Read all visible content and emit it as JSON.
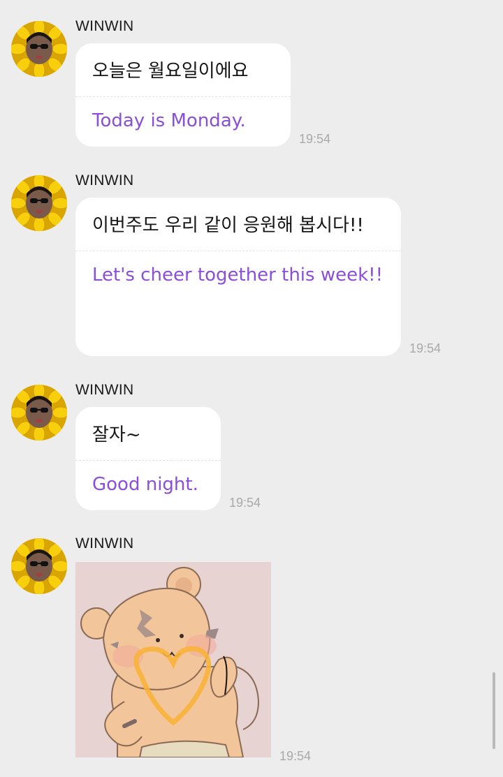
{
  "messages": [
    {
      "sender": "WINWIN",
      "korean": "오늘은 월요일이에요",
      "english": "Today is Monday.",
      "time": "19:54"
    },
    {
      "sender": "WINWIN",
      "korean": "이번주도 우리 같이 응원해 봅시다!!",
      "english": "Let's cheer together this week!!",
      "time": "19:54"
    },
    {
      "sender": "WINWIN",
      "korean": "잘자~",
      "english": "Good night.",
      "time": "19:54"
    },
    {
      "sender": "WINWIN",
      "sticker": "tiger-heart-sticker",
      "time": "19:54"
    }
  ],
  "icons": {
    "avatar": "sunflower-avatar-icon",
    "sticker": "tiger-heart-sticker"
  },
  "colors": {
    "background": "#ededed",
    "bubble": "#ffffff",
    "translation_text": "#8a4fd6",
    "time_text": "#a9a9a9"
  }
}
